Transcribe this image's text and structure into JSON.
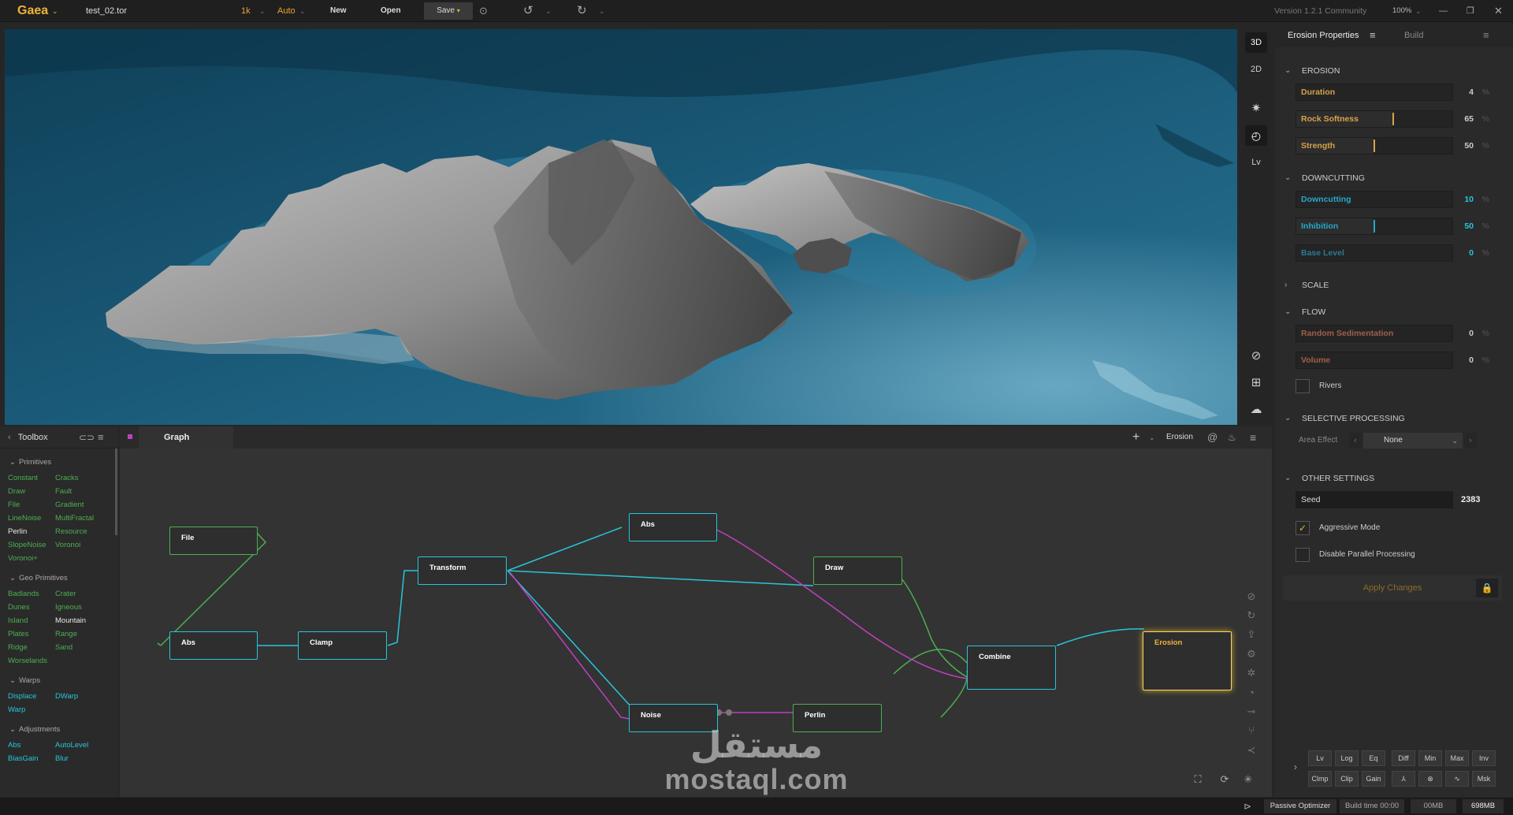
{
  "topbar": {
    "logo": "Gaea",
    "file_name": "test_02.tor",
    "resolution": "1k",
    "auto_mode": "Auto",
    "new_label": "New",
    "open_label": "Open",
    "save_label": "Save",
    "version": "Version 1.2.1 Community",
    "zoom": "100%"
  },
  "viewport_tools": {
    "view_3d": "3D",
    "view_2d": "2D",
    "lv": "Lv"
  },
  "toolbox": {
    "title": "Toolbox",
    "sections": [
      {
        "name": "Primitives",
        "items": [
          "Constant",
          "Cracks",
          "Draw",
          "Fault",
          "File",
          "Gradient",
          "LineNoise",
          "MultiFractal",
          "Perlin",
          "Resource",
          "SlopeNoise",
          "Voronoi",
          "Voronoi+"
        ]
      },
      {
        "name": "Geo Primitives",
        "items": [
          "Badlands",
          "Crater",
          "Dunes",
          "Igneous",
          "Island",
          "Mountain",
          "Plates",
          "Range",
          "Ridge",
          "Sand",
          "Worselands"
        ]
      },
      {
        "name": "Warps",
        "items": [
          "Displace",
          "DWarp",
          "Warp"
        ]
      },
      {
        "name": "Adjustments",
        "items": [
          "Abs",
          "AutoLevel",
          "BiasGain",
          "Blur"
        ]
      }
    ]
  },
  "graph": {
    "tab_label": "Graph",
    "active_node": "Erosion",
    "nodes": [
      "File",
      "Abs",
      "Clamp",
      "Transform",
      "Abs",
      "Draw",
      "Combine",
      "Erosion",
      "Noise",
      "Perlin"
    ]
  },
  "properties": {
    "tab_title": "Erosion Properties",
    "build_tab": "Build",
    "sections": {
      "erosion": "EROSION",
      "downcutting": "DOWNCUTTING",
      "scale": "SCALE",
      "flow": "FLOW",
      "selective": "SELECTIVE PROCESSING",
      "other": "OTHER SETTINGS"
    },
    "duration": {
      "label": "Duration",
      "value": "4",
      "unit": "%"
    },
    "rock_softness": {
      "label": "Rock Softness",
      "value": "65",
      "unit": "%"
    },
    "strength": {
      "label": "Strength",
      "value": "50",
      "unit": "%"
    },
    "downcutting": {
      "label": "Downcutting",
      "value": "10",
      "unit": "%"
    },
    "inhibition": {
      "label": "Inhibition",
      "value": "50",
      "unit": "%"
    },
    "base_level": {
      "label": "Base Level",
      "value": "0",
      "unit": "%"
    },
    "random_sedimentation": {
      "label": "Random Sedimentation",
      "value": "0",
      "unit": "%"
    },
    "volume": {
      "label": "Volume",
      "value": "0",
      "unit": "%"
    },
    "rivers_label": "Rivers",
    "area_effect_label": "Area Effect",
    "area_effect_value": "None",
    "seed_label": "Seed",
    "seed_value": "2383",
    "aggressive_label": "Aggressive Mode",
    "disable_parallel_label": "Disable Parallel Processing",
    "apply_label": "Apply Changes",
    "filters_row1": [
      "Lv",
      "Log",
      "Eq",
      "Diff",
      "Min",
      "Max",
      "Inv"
    ],
    "filters_row2": [
      "Clmp",
      "Clip",
      "Gain",
      "",
      "",
      "",
      "Msk"
    ]
  },
  "status": {
    "optimizer": "Passive Optimizer",
    "build_time": "Build time 00:00",
    "mem1": "00MB",
    "mem2": "698MB"
  },
  "watermark": {
    "arabic": "مستقل",
    "latin": "mostaql.com"
  },
  "colors": {
    "accent": "#f0b23a",
    "cyan": "#26c6da",
    "green": "#4caf50",
    "magenta": "#c040c0",
    "ocean": "#17506c"
  }
}
